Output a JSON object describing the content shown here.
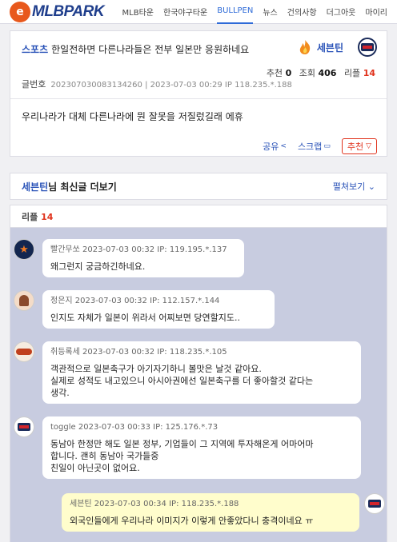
{
  "site": {
    "logo_initial": "e",
    "logo_text": "MLBPARK"
  },
  "nav": [
    "MLB타운",
    "한국야구타운",
    "BULLPEN",
    "뉴스",
    "건의사항",
    "더그아웃",
    "마이리"
  ],
  "article": {
    "category": "스포츠",
    "title": "한일전하면 다른나라들은 전부 일본만 응원하네요",
    "author": "세븐틴",
    "stats": {
      "rec_label": "추천",
      "rec": "0",
      "views_label": "조회",
      "views": "406",
      "replies_label": "리플",
      "replies": "14"
    },
    "meta_label": "글번호",
    "meta": "202307030083134260 | 2023-07-03 00:29  IP 118.235.*.188",
    "body": "우리나라가 대체 다른나라에 뭔 잘못을 저질렀길래 에휴",
    "actions": {
      "share": "공유",
      "share_icon": "<",
      "capture": "스크랩",
      "capture_icon": "▭",
      "recommend": "추천",
      "recommend_icon": "▽"
    }
  },
  "latest": {
    "name": "세븐틴",
    "suffix": "님 최신글 더보기",
    "expand": "펼쳐보기 ⌄"
  },
  "replies_header": {
    "label": "리플",
    "count": "14"
  },
  "replies": [
    {
      "author": "빨간무쏘",
      "header": "2023-07-03 00:32 IP: 119.195.*.137",
      "text": "왜그런지 궁금하긴하네요."
    },
    {
      "author": "정은지",
      "header": "2023-07-03 00:32 IP: 112.157.*.144",
      "text": "인지도 자체가 일본이 위라서 어찌보면 당연할지도.."
    },
    {
      "author": "취등록세",
      "header": "2023-07-03 00:32 IP: 118.235.*.105",
      "text": "객관적으로 일본축구가 아기자기하니 볼맛은 날것 같아요.\n실제로 성적도 내고있으니 아시아권에선 일본축구를 더 좋아할것 같다는\n생각."
    },
    {
      "author": "toggle",
      "header": "2023-07-03 00:33 IP: 125.176.*.73",
      "text": "동남아 한정만 해도 일본 정부, 기업들이 그 지역에 투자해온게 어마어마\n합니다. 괜히 동남아 국가들중\n친일이 아닌곳이 없어요."
    },
    {
      "author": "세븐틴",
      "header": "2023-07-03 00:34 IP: 118.235.*.188",
      "text": "외국인들에게 우리나라 이미지가 이렇게 안좋았다니 충격이네요 ㅠ"
    }
  ],
  "colors": {
    "brand_blue": "#1f3e8c",
    "accent_orange": "#e8581c",
    "link_blue": "#2a53b8",
    "red": "#e0321c",
    "mine_bubble": "#fffdcc",
    "reply_bg": "#c8cce0"
  }
}
